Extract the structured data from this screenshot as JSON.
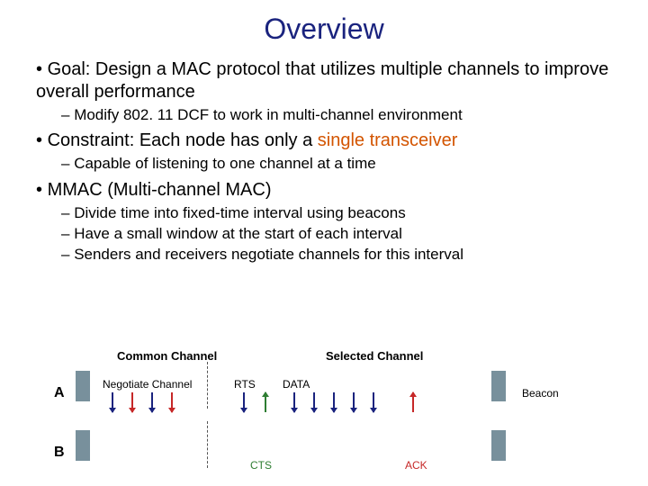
{
  "title": "Overview",
  "bullets": {
    "b1a_pre": "Goal: Design a MAC protocol that utilizes multiple channels to improve overall performance",
    "b2a": "Modify 802. 11 DCF to work in multi-channel environment",
    "b1b_pre": "Constraint: Each node has only a ",
    "b1b_em": "single transceiver",
    "b2b": "Capable of listening to one channel at a time",
    "b1c": "MMAC (Multi-channel MAC)",
    "b2c1": "Divide time into fixed-time interval using beacons",
    "b2c2": "Have a small window at the start of each interval",
    "b2c3": "Senders and receivers negotiate channels for this interval"
  },
  "diagram": {
    "common_label": "Common Channel",
    "selected_label": "Selected Channel",
    "rowA": "A",
    "rowB": "B",
    "negotiate": "Negotiate Channel",
    "rts": "RTS",
    "data": "DATA",
    "cts": "CTS",
    "ack": "ACK",
    "beacon": "Beacon"
  }
}
